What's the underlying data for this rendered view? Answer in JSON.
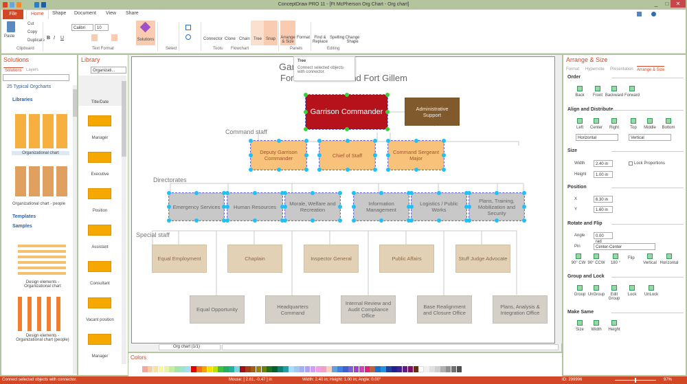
{
  "window": {
    "title": "ConceptDraw PRO 11 - [Ft McPherson Org Chart - Org chart]",
    "minimize": "_",
    "maximize": "□",
    "close": "✕"
  },
  "menu": {
    "file": "File",
    "tabs": [
      "Home",
      "Shape",
      "Document",
      "View",
      "Share"
    ]
  },
  "ribbon": {
    "clipboard": {
      "label": "Clipboard",
      "paste": "Paste",
      "cut": "Cut",
      "copy": "Copy",
      "duplicate": "Duplicate"
    },
    "text_format": {
      "label": "Text Format",
      "font": "Calibri",
      "size": "10",
      "bold": "B",
      "italic": "I",
      "underline": "U"
    },
    "solutions": "Solutions",
    "select": {
      "label": "Select"
    },
    "tools": {
      "label": "Tools"
    },
    "flowchart": {
      "label": "Flowchart",
      "connector": "Connector",
      "clone": "Clone",
      "chain": "Chain",
      "tree": "Tree",
      "snap": "Snap"
    },
    "panels": {
      "label": "Panels",
      "arrange": "Arrange & Size",
      "format": "Format"
    },
    "editing": {
      "label": "Editing",
      "find": "Find & Replace",
      "spelling": "Spelling",
      "change_shape": "Change Shape"
    }
  },
  "tooltip": {
    "title": "Tree",
    "text": "Connect selected objects with connector."
  },
  "solutions_panel": {
    "title": "Solutions",
    "tabs": [
      "Solutions",
      "Layers"
    ],
    "search_placeholder": "",
    "tree_root": "25 Typical Orgcharts",
    "libraries": "Libraries",
    "lib_items": [
      "Organizational chart",
      "Organizational chart - people"
    ],
    "templates": "Templates",
    "samples": "Samples",
    "sample_items": [
      "Design elements - Organizational chart",
      "Design elements - Organizational chart (people)"
    ]
  },
  "library_panel": {
    "title": "Library",
    "dropdown": "Organizati...",
    "items": [
      "Title/Date",
      "Manager",
      "Executive",
      "Position",
      "Assistant",
      "Consultant",
      "Vacant position",
      "Manager"
    ]
  },
  "chart": {
    "title1": "Garrison",
    "title2": "Fort McPherson and Fort Gillem",
    "labels": {
      "command": "Command staff",
      "directorates": "Directorates",
      "special": "Special staff"
    },
    "commander": "Garrison Commander",
    "admin": "Administrative Support",
    "command_staff": [
      "Deputy Garrison Commander",
      "Chief of Staff",
      "Command Sergeant Major"
    ],
    "directorates": [
      "Emergency Services",
      "Human Resources",
      "Morale, Welfare and Recreation",
      "Information Management",
      "Logistics / Public Works",
      "Plans, Training, Mobilization and Security"
    ],
    "special_row1": [
      "Equal Employment",
      "Chaplain",
      "Inspector General",
      "Public Affairs",
      "Stuff Judge Advocate"
    ],
    "special_row2": [
      "Equal Opportunity",
      "Headquarters Command",
      "Internal Review and Audit Compliance Office",
      "Base Realignment and Closure Office",
      "Plans, Analysis & Integration Office"
    ],
    "colors": {
      "commander": "#b5121b",
      "admin": "#80592c",
      "command_staff": "#f8c27a",
      "directorates": "#c8c8c8",
      "special1": "#e2d1b4",
      "special2": "#d4d0c8"
    }
  },
  "page_tab": "Org chart (1/1)",
  "colors_panel": {
    "title": "Colors",
    "palette": [
      "#f4a8a0",
      "#f8d0a0",
      "#fbe0a0",
      "#fdf4a0",
      "#e8f4a0",
      "#c8eca0",
      "#a8e4a8",
      "#a0e4d0",
      "#a8e0f0",
      "#e00000",
      "#f07020",
      "#f8a000",
      "#f8e000",
      "#c0e000",
      "#40c040",
      "#20b060",
      "#20b0a0",
      "#80d0e0",
      "#a01010",
      "#a04010",
      "#a06010",
      "#a08000",
      "#708000",
      "#207020",
      "#006030",
      "#108070",
      "#20a0a0",
      "#a0e0f8",
      "#a0c8f0",
      "#a0b0f0",
      "#b0a0f0",
      "#d0a0f0",
      "#f0a0e0",
      "#f0a0c0",
      "#f8d0c0",
      "#60a0e0",
      "#4080e0",
      "#4060d0",
      "#8060d0",
      "#a040d0",
      "#d040c0",
      "#e02080",
      "#c06040",
      "#2070c0",
      "#2090e0",
      "#2040a0",
      "#202090",
      "#402090",
      "#602080",
      "#801060",
      "#603010",
      "#ffffff",
      "#f0f0f0",
      "#e0e0e0",
      "#d0d0d0",
      "#b0b0b0",
      "#909090",
      "#707070",
      "#505050"
    ]
  },
  "arrange_panel": {
    "title": "Arrange & Size",
    "tabs": [
      "Format",
      "Hypernote",
      "Presentation",
      "Arrange & Size"
    ],
    "order": {
      "title": "Order",
      "buttons": [
        "Back",
        "Front",
        "Backward",
        "Forward"
      ]
    },
    "align": {
      "title": "Align and Distribute",
      "buttons": [
        "Left",
        "Center",
        "Right",
        "Top",
        "Middle",
        "Bottom"
      ],
      "horizontal": "Horizontal",
      "vertical": "Vertical"
    },
    "size": {
      "title": "Size",
      "width_label": "Width",
      "width": "2.40 in",
      "height_label": "Height",
      "height": "1.00 in",
      "lock": "Lock Proportions"
    },
    "position": {
      "title": "Position",
      "x_label": "X",
      "x": "6.30 in",
      "y_label": "Y",
      "y": "1.60 in"
    },
    "rotate": {
      "title": "Rotate and Flip",
      "angle_label": "Angle",
      "angle": "0.00 rad",
      "pin_label": "Pin",
      "pin": "Center-Center",
      "buttons": [
        "90° CW",
        "90° CCW",
        "180 °",
        "Vertical",
        "Horizontal"
      ],
      "flip": "Flip"
    },
    "group": {
      "title": "Group and Lock",
      "buttons": [
        "Group",
        "UnGroup",
        "Edit Group",
        "Lock",
        "UnLock"
      ]
    },
    "same": {
      "title": "Make Same",
      "buttons": [
        "Size",
        "Width",
        "Height"
      ]
    }
  },
  "status": {
    "message": "Connect selected objects with connector.",
    "mouse": "Mouse: [ 2.61, -0.47 ] in",
    "dims": "Width: 2.40 in;  Height: 1.00 in;  Angle: 0.00°",
    "id": "ID: 299996",
    "zoom": "97%",
    "zoom_level": 97
  }
}
